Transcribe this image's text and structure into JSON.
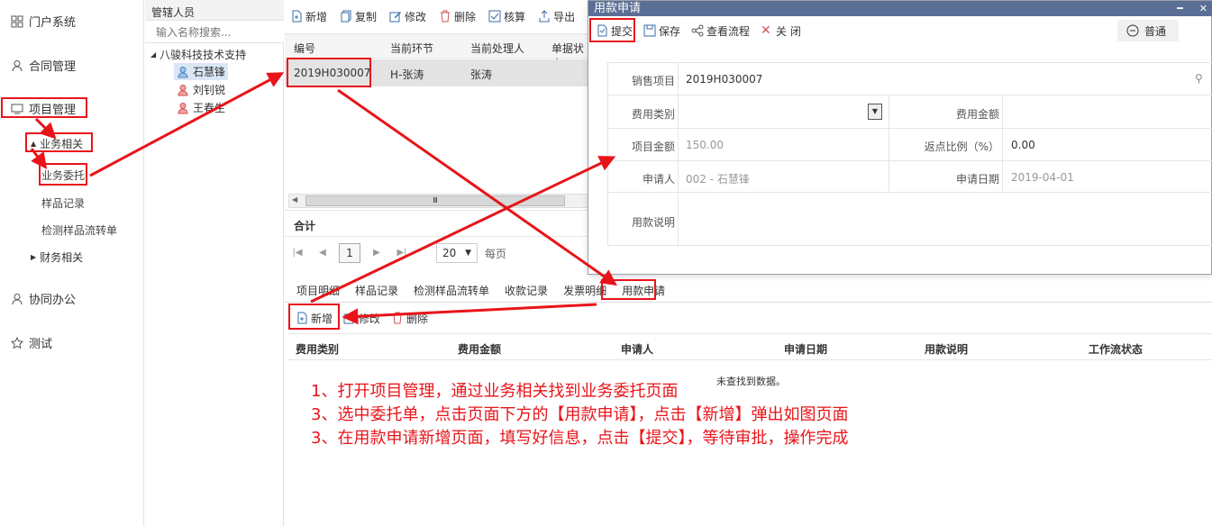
{
  "nav": {
    "portal": "门户系统",
    "contract": "合同管理",
    "project": "项目管理",
    "business_group": "业务相关",
    "business_entrust": "业务委托",
    "sample_record": "样品记录",
    "sample_transfer": "检测样品流转单",
    "finance_group": "财务相关",
    "collab": "协同办公",
    "test": "测试"
  },
  "tree": {
    "header": "管辖人员",
    "search_placeholder": "输入名称搜索...",
    "org": "八骏科技技术支持",
    "people": [
      "石慧锋",
      "刘钊锐",
      "王春生"
    ]
  },
  "toolbar": {
    "add": "新增",
    "copy": "复制",
    "edit": "修改",
    "delete": "删除",
    "audit": "核算",
    "export": "导出"
  },
  "grid": {
    "columns": [
      "编号",
      "当前环节",
      "当前处理人",
      "单据状态"
    ],
    "row": {
      "code": "2019H030007",
      "stage": "H-张涛",
      "handler": "张涛"
    },
    "total_label": "合计",
    "scroll_grip": "Ⅲ",
    "page": "1",
    "page_size": "20",
    "per_page_label": "每页"
  },
  "tabs": [
    "项目明细",
    "样品记录",
    "检测样品流转单",
    "收款记录",
    "发票明细",
    "用款申请"
  ],
  "tab_actions": {
    "add": "新增",
    "edit": "修改",
    "delete": "删除"
  },
  "sub_grid": {
    "columns": [
      "费用类别",
      "费用金额",
      "申请人",
      "申请日期",
      "用款说明",
      "工作流状态"
    ],
    "empty": "未查找到数据。"
  },
  "dialog": {
    "title": "用款申请",
    "submit": "提交",
    "save": "保存",
    "view_flow": "查看流程",
    "close": "关 闭",
    "mode": "普通",
    "fields": {
      "sales_project_label": "销售项目",
      "sales_project_value": "2019H030007",
      "fee_type_label": "费用类别",
      "fee_amount_label": "费用金额",
      "project_amount_label": "项目金额",
      "project_amount_value": "150.00",
      "rebate_label": "返点比例（%）",
      "rebate_value": "0.00",
      "applicant_label": "申请人",
      "applicant_value": "002 - 石慧锋",
      "apply_date_label": "申请日期",
      "apply_date_value": "2019-04-01",
      "remark_label": "用款说明"
    }
  },
  "instructions": [
    "1、打开项目管理，通过业务相关找到业务委托页面",
    "3、选中委托单，点击页面下方的【用款申请】，点击【新增】弹出如图页面",
    "3、在用款申请新增页面，填写好信息，点击【提交】，等待审批，操作完成"
  ],
  "colors": {
    "annotation": "#e8141a",
    "dialog_title_bg": "#5b6f96",
    "selected_row": "#e3e3e3"
  }
}
